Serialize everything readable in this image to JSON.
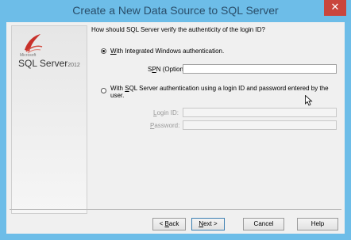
{
  "window": {
    "title": "Create a New Data Source to SQL Server",
    "close_glyph": "✕"
  },
  "logo": {
    "brand_small": "Microsoft",
    "product": "SQL Server",
    "version": "2012"
  },
  "question": "How should SQL Server verify the authenticity of the login ID?",
  "option_windows": {
    "prefix": "",
    "accel": "W",
    "rest": "ith Integrated Windows authentication.",
    "selected": true
  },
  "spn": {
    "label_pre": "S",
    "label_accel": "P",
    "label_post": "N (Optional):",
    "value": ""
  },
  "option_sql": {
    "pre": "With ",
    "accel": "S",
    "rest": "QL Server authentication using a login ID and password entered by the user.",
    "selected": false
  },
  "login": {
    "label_pre": "",
    "label_accel": "L",
    "label_post": "ogin ID:",
    "value": ""
  },
  "password": {
    "label_pre": "",
    "label_accel": "P",
    "label_post": "assword:",
    "value": ""
  },
  "buttons": {
    "back": {
      "pre": "< ",
      "accel": "B",
      "post": "ack"
    },
    "next": {
      "pre": "",
      "accel": "N",
      "post": "ext >"
    },
    "cancel": "Cancel",
    "help": "Help"
  }
}
